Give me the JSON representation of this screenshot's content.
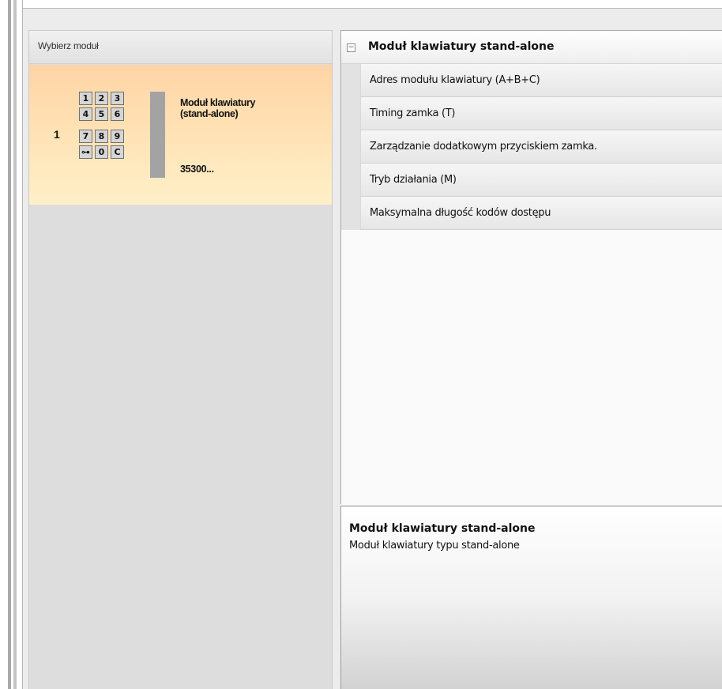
{
  "module_selector": {
    "header": "Wybierz moduł",
    "modules": [
      {
        "index": "1",
        "name": "Moduł klawiatury\n(stand-alone)",
        "code": "35300...",
        "selected": true,
        "keypad_keys": [
          "1",
          "2",
          "3",
          "4",
          "5",
          "6",
          "7",
          "8",
          "9",
          "⊶",
          "0",
          "C"
        ]
      }
    ]
  },
  "properties": {
    "category": {
      "label": "Moduł klawiatury stand-alone",
      "toggle": "−",
      "expanded": true
    },
    "items": [
      {
        "label": "Adres modułu klawiatury (A+B+C)"
      },
      {
        "label": "Timing zamka (T)"
      },
      {
        "label": "Zarządzanie dodatkowym przyciskiem zamka."
      },
      {
        "label": "Tryb działania (M)"
      },
      {
        "label": "Maksymalna długość kodów dostępu"
      }
    ]
  },
  "description": {
    "title": "Moduł klawiatury stand-alone",
    "text": "Moduł klawiatury typu stand-alone"
  },
  "colors": {
    "selected_card_top": "#ffd4a6",
    "selected_card_bottom": "#fff0c8",
    "panel_background": "#dddddd",
    "property_row": "#eeeeee"
  }
}
